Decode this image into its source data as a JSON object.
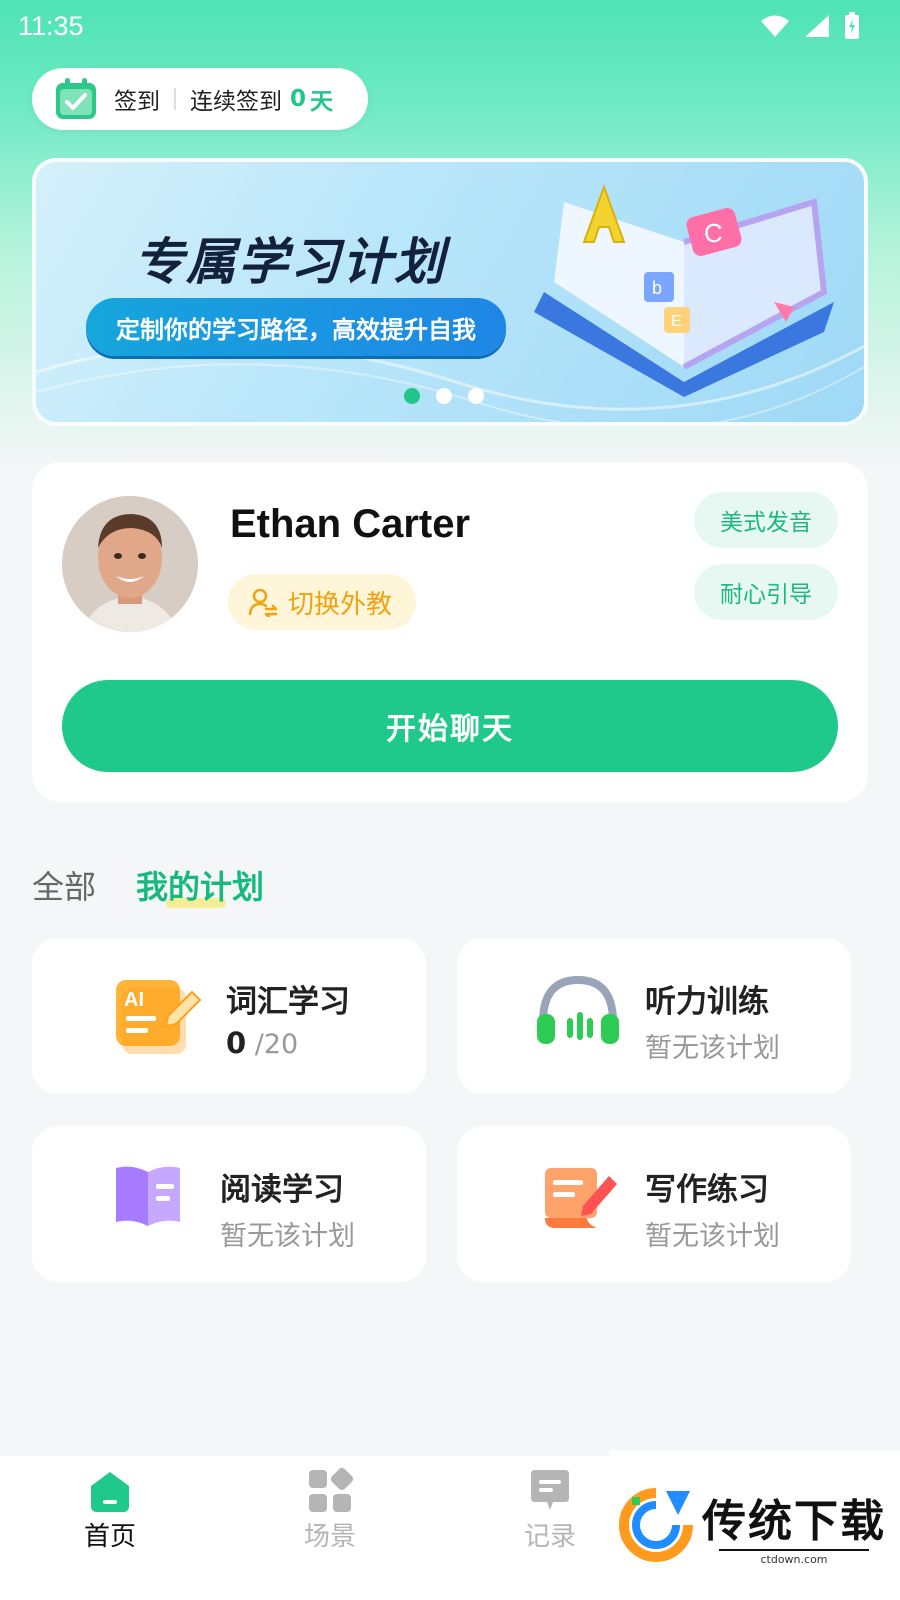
{
  "status_bar": {
    "time": "11:35"
  },
  "checkin": {
    "label": "签到",
    "streak_label": "连续签到",
    "streak_days": "0",
    "streak_unit": "天"
  },
  "banner": {
    "title": "专属学习计划",
    "subtitle": "定制你的学习路径，高效提升自我",
    "slide_count": 3,
    "active_slide": 1
  },
  "teacher": {
    "name": "Ethan Carter",
    "switch_label": "切换外教",
    "tags": [
      "美式发音",
      "耐心引导"
    ],
    "chat_button": "开始聊天"
  },
  "tabs": [
    {
      "label": "全部",
      "active": false
    },
    {
      "label": "我的计划",
      "active": true
    }
  ],
  "plans": [
    {
      "title": "词汇学习",
      "progress_done": "0",
      "progress_total": "/20",
      "icon": "ai-vocabulary-icon"
    },
    {
      "title": "听力训练",
      "subtitle": "暂无该计划",
      "icon": "headphones-icon"
    },
    {
      "title": "阅读学习",
      "subtitle": "暂无该计划",
      "icon": "book-icon"
    },
    {
      "title": "写作练习",
      "subtitle": "暂无该计划",
      "icon": "scroll-pen-icon"
    }
  ],
  "bottom_nav": [
    {
      "label": "首页",
      "icon": "home-icon",
      "active": true
    },
    {
      "label": "场景",
      "icon": "grid-icon",
      "active": false
    },
    {
      "label": "记录",
      "icon": "chat-record-icon",
      "active": false
    }
  ],
  "watermark": {
    "title": "传统下载",
    "url": "ctdown.com"
  },
  "colors": {
    "accent": "#1fc98b",
    "switch_text": "#f2a20f"
  }
}
